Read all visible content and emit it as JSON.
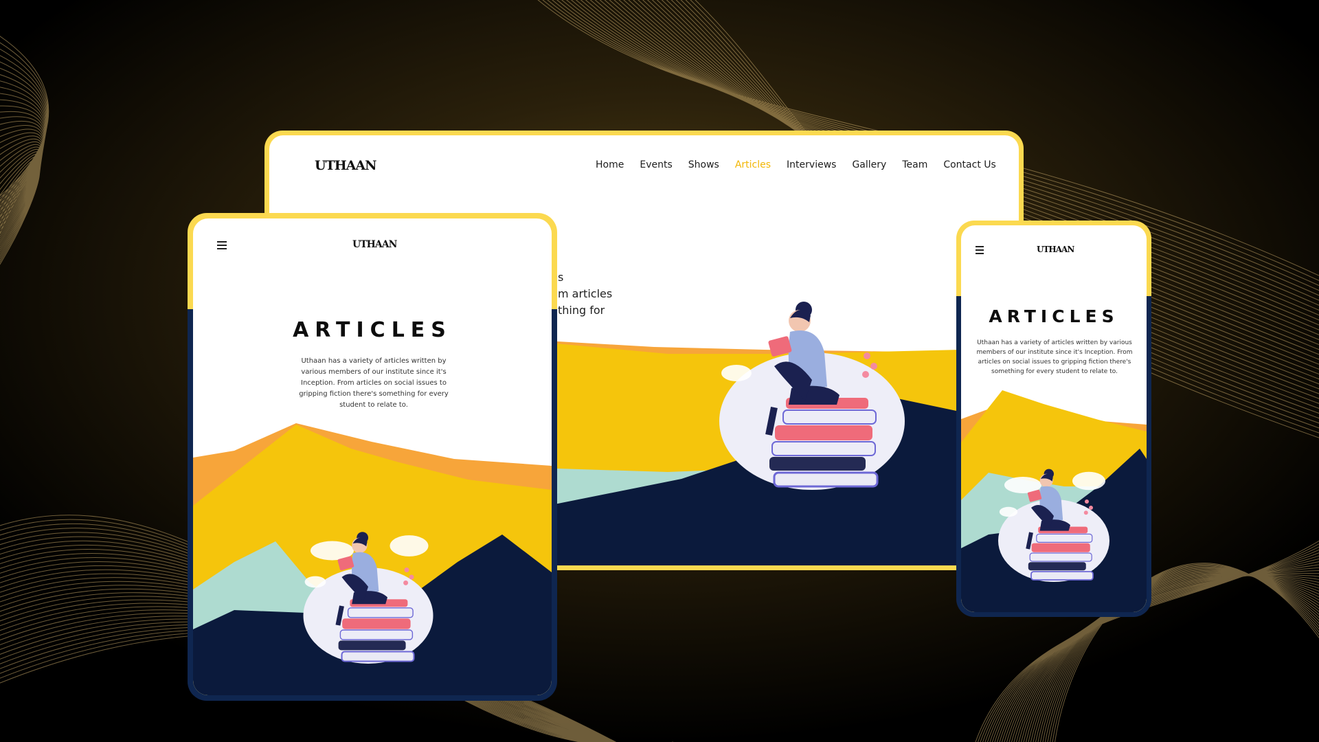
{
  "brand": {
    "logo": "UTHAAN"
  },
  "desktop": {
    "nav": [
      "Home",
      "Events",
      "Shows",
      "Articles",
      "Interviews",
      "Gallery",
      "Team",
      "Contact Us"
    ],
    "active_nav": "Articles",
    "partial_text": [
      "s",
      "m articles",
      "thing for"
    ]
  },
  "tablet": {
    "heading": "ARTICLES",
    "description": "Uthaan has a variety of articles written by various members of our institute since it's Inception. From articles on social issues to gripping fiction there's something for every student to relate to."
  },
  "mobile": {
    "heading": "ARTICLES",
    "description": "Uthaan has a variety of articles written by various members of our institute since it's Inception. From articles on social issues to gripping fiction there's something for every student to relate to."
  },
  "colors": {
    "frame": "#fbd950",
    "navy": "#0b1a3c",
    "yellow": "#f5c50c",
    "orange": "#f7a53a",
    "mint": "#aedbd0",
    "active_link": "#f2b705"
  },
  "icons": [
    "hamburger-menu-icon",
    "logo-icon",
    "reading-woman-illustration",
    "book-stack-illustration",
    "cloud-illustration"
  ]
}
